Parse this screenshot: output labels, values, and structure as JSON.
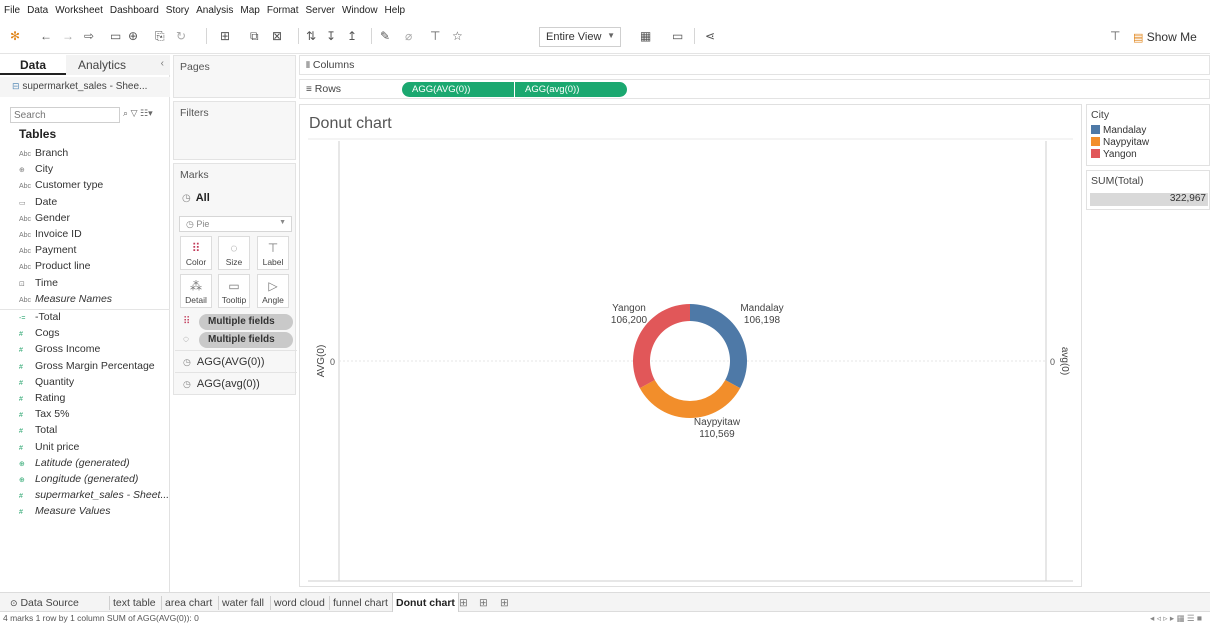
{
  "menu": [
    "File",
    "Data",
    "Worksheet",
    "Dashboard",
    "Story",
    "Analysis",
    "Map",
    "Format",
    "Server",
    "Window",
    "Help"
  ],
  "toolbar": {
    "fit": "Entire View",
    "show_me": "Show Me"
  },
  "data_pane": {
    "tab_data": "Data",
    "tab_analytics": "Analytics",
    "datasource": "supermarket_sales - Shee...",
    "search_placeholder": "Search",
    "tables_heading": "Tables",
    "dimensions": [
      {
        "icon": "Abc",
        "name": "Branch"
      },
      {
        "icon": "⊕",
        "name": "City"
      },
      {
        "icon": "Abc",
        "name": "Customer type"
      },
      {
        "icon": "▭",
        "name": "Date"
      },
      {
        "icon": "Abc",
        "name": "Gender"
      },
      {
        "icon": "Abc",
        "name": "Invoice ID"
      },
      {
        "icon": "Abc",
        "name": "Payment"
      },
      {
        "icon": "Abc",
        "name": "Product line"
      },
      {
        "icon": "⊡",
        "name": "Time"
      },
      {
        "icon": "Abc",
        "name": "Measure Names"
      }
    ],
    "measures": [
      {
        "icon": "-=",
        "name": "-Total"
      },
      {
        "icon": "#",
        "name": "Cogs"
      },
      {
        "icon": "#",
        "name": "Gross Income"
      },
      {
        "icon": "#",
        "name": "Gross Margin Percentage"
      },
      {
        "icon": "#",
        "name": "Quantity"
      },
      {
        "icon": "#",
        "name": "Rating"
      },
      {
        "icon": "#",
        "name": "Tax 5%"
      },
      {
        "icon": "#",
        "name": "Total"
      },
      {
        "icon": "#",
        "name": "Unit price"
      },
      {
        "icon": "⊕",
        "name": "Latitude (generated)"
      },
      {
        "icon": "⊕",
        "name": "Longitude (generated)"
      },
      {
        "icon": "#",
        "name": "supermarket_sales - Sheet..."
      },
      {
        "icon": "#",
        "name": "Measure Values"
      }
    ]
  },
  "cards": {
    "pages": "Pages",
    "filters": "Filters",
    "marks": "Marks"
  },
  "marks": {
    "all": "All",
    "type": "Pie",
    "buttons": [
      "Color",
      "Size",
      "Label",
      "Detail",
      "Tooltip",
      "Angle"
    ],
    "pill_color": "Multiple fields",
    "pill_size": "Multiple fields",
    "agg1": "AGG(AVG(0))",
    "agg2": "AGG(avg(0))"
  },
  "shelves": {
    "columns_label": "Columns",
    "rows_label": "Rows",
    "row_pills": [
      "AGG(AVG(0))",
      "AGG(avg(0))"
    ]
  },
  "chart_data": {
    "type": "pie",
    "title": "Donut chart",
    "categories": [
      "Mandalay",
      "Naypyitaw",
      "Yangon"
    ],
    "values": [
      106198,
      110569,
      106200
    ],
    "value_labels": [
      "106,198",
      "110,569",
      "106,200"
    ],
    "colors": [
      "#4e79a7",
      "#f28e2b",
      "#e15759"
    ],
    "left_axis_label": "AVG(0)",
    "right_axis_label": "avg(0)",
    "left_tick": "0",
    "right_tick": "0"
  },
  "legend_city": {
    "title": "City",
    "items": [
      {
        "name": "Mandalay",
        "color": "#4e79a7"
      },
      {
        "name": "Naypyitaw",
        "color": "#f28e2b"
      },
      {
        "name": "Yangon",
        "color": "#e15759"
      }
    ]
  },
  "legend_size": {
    "title": "SUM(Total)",
    "value": "322,967"
  },
  "sheet_tabs": [
    "text table",
    "area chart",
    "water fall",
    "word cloud",
    "funnel chart",
    "Donut chart"
  ],
  "data_source_tab": "Data Source",
  "status": "4 marks    1 row by 1 column    SUM of AGG(AVG(0)): 0"
}
